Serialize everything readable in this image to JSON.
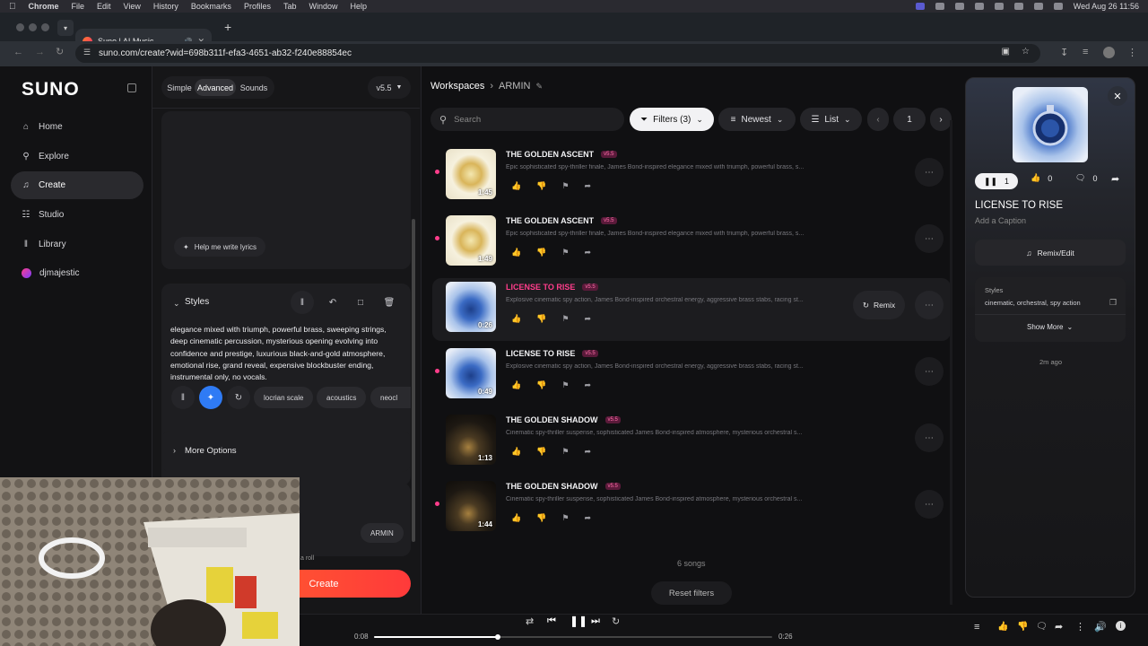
{
  "menubar": {
    "app": "Chrome",
    "items": [
      "File",
      "Edit",
      "View",
      "History",
      "Bookmarks",
      "Profiles",
      "Tab",
      "Window",
      "Help"
    ],
    "clock": "Wed Aug 26  11:56"
  },
  "browser": {
    "tab_title": "Suno | AI Music",
    "url": "suno.com/create?wid=698b311f-efa3-4651-ab32-f240e88854ec"
  },
  "sidebar": {
    "logo": "SUNO",
    "items": [
      {
        "label": "Home",
        "icon": "home-icon"
      },
      {
        "label": "Explore",
        "icon": "search-icon"
      },
      {
        "label": "Create",
        "icon": "create-icon"
      },
      {
        "label": "Studio",
        "icon": "studio-icon"
      },
      {
        "label": "Library",
        "icon": "library-icon"
      },
      {
        "label": "djmajestic",
        "icon": "avatar"
      }
    ]
  },
  "create": {
    "modes": [
      "Simple",
      "Advanced",
      "Sounds"
    ],
    "active_mode": "Advanced",
    "model": "v5.5",
    "lyrics_helper": "Help me write lyrics",
    "styles_label": "Styles",
    "styles_text": "elegance mixed with triumph, powerful brass, sweeping strings, deep cinematic percussion, mysterious opening evolving into confidence and prestige, luxurious black-and-gold atmosphere, emotional rise, grand reveal, expensive blockbuster ending, instrumental only, no vocals.",
    "style_tags": [
      "locrian scale",
      "acoustics",
      "neocl"
    ],
    "more_options": "More Options",
    "workspace_chip": "ARMIN",
    "partial_hint": "a roll",
    "create_button": "Create"
  },
  "main": {
    "breadcrumb_root": "Workspaces",
    "breadcrumb_current": "ARMIN",
    "search_placeholder": "Search",
    "filters_label": "Filters (3)",
    "sort_label": "Newest",
    "view_label": "List",
    "page": "1",
    "songs": [
      {
        "title": "THE GOLDEN ASCENT",
        "version": "v5.5",
        "desc": "Epic sophisticated spy-thriller finale, James Bond-inspired elegance mixed with triumph, powerful brass, s...",
        "duration": "1:45",
        "art": "gold",
        "dot": true,
        "selected": false
      },
      {
        "title": "THE GOLDEN ASCENT",
        "version": "v5.5",
        "desc": "Epic sophisticated spy-thriller finale, James Bond-inspired elegance mixed with triumph, powerful brass, s...",
        "duration": "1:49",
        "art": "gold",
        "dot": true,
        "selected": false
      },
      {
        "title": "LICENSE TO RISE",
        "version": "v5.5",
        "desc": "Explosive cinematic spy action, James Bond-inspired orchestral energy, aggressive brass stabs, racing st...",
        "duration": "0:26",
        "art": "blue",
        "dot": false,
        "selected": true,
        "remix": "Remix"
      },
      {
        "title": "LICENSE TO RISE",
        "version": "v5.5",
        "desc": "Explosive cinematic spy action, James Bond-inspired orchestral energy, aggressive brass stabs, racing st...",
        "duration": "0:49",
        "art": "blue",
        "dot": true,
        "selected": false
      },
      {
        "title": "THE GOLDEN SHADOW",
        "version": "v5.5",
        "desc": "Cinematic spy-thriller suspense, sophisticated James Bond-inspired atmosphere, mysterious orchestral s...",
        "duration": "1:13",
        "art": "dark",
        "dot": false,
        "selected": false
      },
      {
        "title": "THE GOLDEN SHADOW",
        "version": "v5.5",
        "desc": "Cinematic spy-thriller suspense, sophisticated James Bond-inspired atmosphere, mysterious orchestral s...",
        "duration": "1:44",
        "art": "dark",
        "dot": true,
        "selected": false
      }
    ],
    "count_label": "6 songs",
    "reset_label": "Reset filters"
  },
  "detail": {
    "plays": "1",
    "likes": "0",
    "comments": "0",
    "title": "LICENSE TO RISE",
    "caption_placeholder": "Add a Caption",
    "remix_label": "Remix/Edit",
    "styles_label": "Styles",
    "styles_value": "cinematic, orchestral, spy action",
    "show_more": "Show More",
    "time_ago": "2m ago"
  },
  "player": {
    "elapsed": "0:08",
    "total": "0:26",
    "progress": 0.31
  },
  "colors": {
    "accent": "#ff3d8b",
    "create_gradient_start": "#ff6a2a",
    "create_gradient_end": "#ff3a3a"
  }
}
